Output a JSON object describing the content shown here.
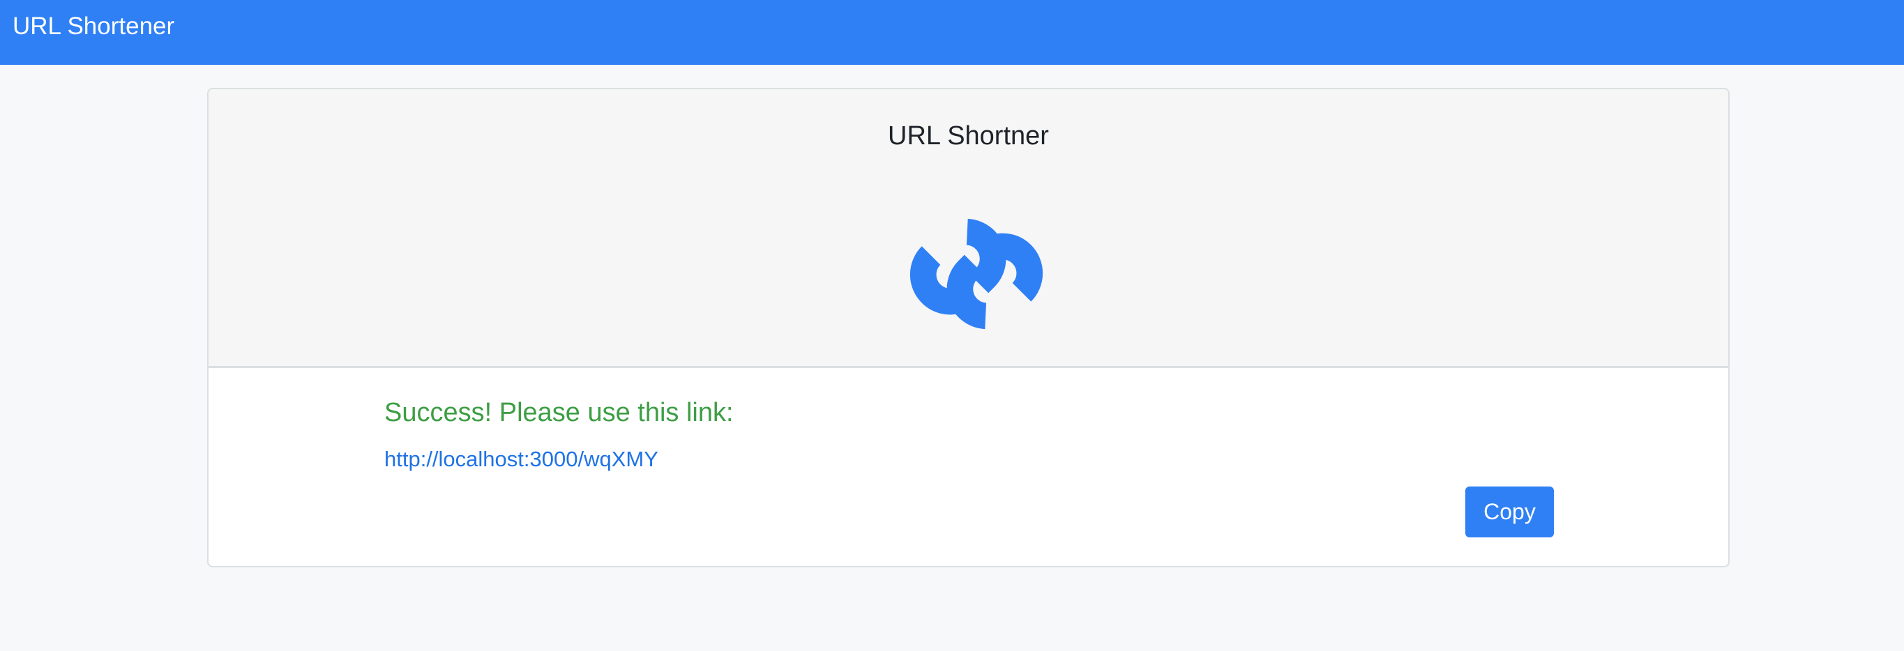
{
  "navbar": {
    "brand": "URL Shortener"
  },
  "card": {
    "title": "URL Shortner",
    "icon": "link-icon"
  },
  "result": {
    "success_message": "Success! Please use this link:",
    "short_url": "http://localhost:3000/wqXMY",
    "copy_label": "Copy"
  },
  "colors": {
    "primary": "#2f80f5",
    "success": "#3d9e44",
    "link": "#1f72e6",
    "background": "#f7f8f9",
    "header_bg": "#f6f6f6"
  }
}
